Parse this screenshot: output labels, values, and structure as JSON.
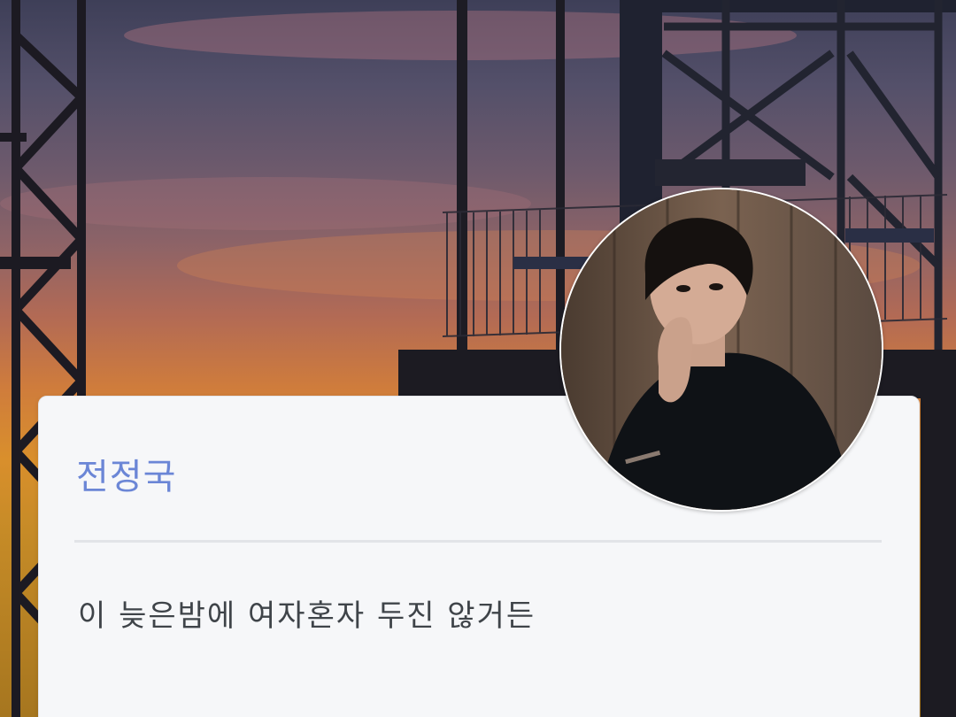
{
  "profile": {
    "name": "전정국",
    "message": "이 늦은밤에 여자혼자 두진 않거든"
  },
  "colors": {
    "name_accent": "#6b86d6",
    "message_text": "#3f4449",
    "card_background": "#f6f7f9"
  },
  "icons": {
    "avatar": "profile-photo",
    "background": "sunset-scaffold-photo"
  }
}
